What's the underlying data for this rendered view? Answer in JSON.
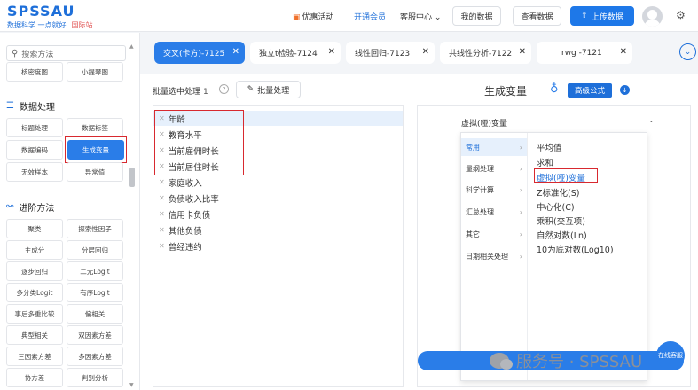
{
  "header": {
    "logo": "SPSSAU",
    "tagline": "数据科学 一点就好",
    "intl": "国际站",
    "promo": "优惠活动",
    "vip": "开通会员",
    "service": "客服中心",
    "service_caret": "⌄",
    "my_data": "我的数据",
    "view_data": "查看数据",
    "upload": "上传数据"
  },
  "sidebar": {
    "search_placeholder": "搜索方法",
    "top_items": [
      "核密度图",
      "小提琴图"
    ],
    "section_data": "数据处理",
    "data_items": [
      "标题处理",
      "数据标签",
      "数据编码",
      "生成变量",
      "无效样本",
      "异常值"
    ],
    "section_adv": "进阶方法",
    "adv_items": [
      "聚类",
      "探索性因子",
      "主成分",
      "分层回归",
      "逐步回归",
      "二元Logit",
      "多分类Logit",
      "有序Logit",
      "事后多重比较",
      "偏相关",
      "典型相关",
      "双因素方差",
      "三因素方差",
      "多因素方差",
      "协方差",
      "判别分析"
    ]
  },
  "tabs": [
    {
      "label": "交叉(卡方)-7125"
    },
    {
      "label": "独立t检验-7124"
    },
    {
      "label": "线性回归-7123"
    },
    {
      "label": "共线性分析-7122"
    },
    {
      "label": "rwg -7121"
    }
  ],
  "tabs_toggle": "⌄",
  "batch": {
    "label": "批量选中处理",
    "count": "1",
    "help": "?",
    "button": "批量处理"
  },
  "variables": [
    "年龄",
    "教育水平",
    "当前雇佣时长",
    "当前居住时长",
    "家庭收入",
    "负债收入比率",
    "信用卡负债",
    "其他负债",
    "曾经违约"
  ],
  "generate": {
    "title": "生成变量",
    "advanced": "高级公式",
    "selected": "虚拟(哑)变量"
  },
  "dropdown": {
    "categories": [
      "常用",
      "量纲处理",
      "科学计算",
      "汇总处理",
      "其它",
      "日期相关处理"
    ],
    "options": [
      "平均值",
      "求和",
      "虚拟(哑)变量",
      "Z标准化(S)",
      "中心化(C)",
      "乘积(交互项)",
      "自然对数(Ln)",
      "10为底对数(Log10)"
    ]
  },
  "watermark": "服务号 · SPSSAU",
  "support_label": "在线客服",
  "colors": {
    "accent": "#2a7de8",
    "highlight": "#d8292f"
  }
}
